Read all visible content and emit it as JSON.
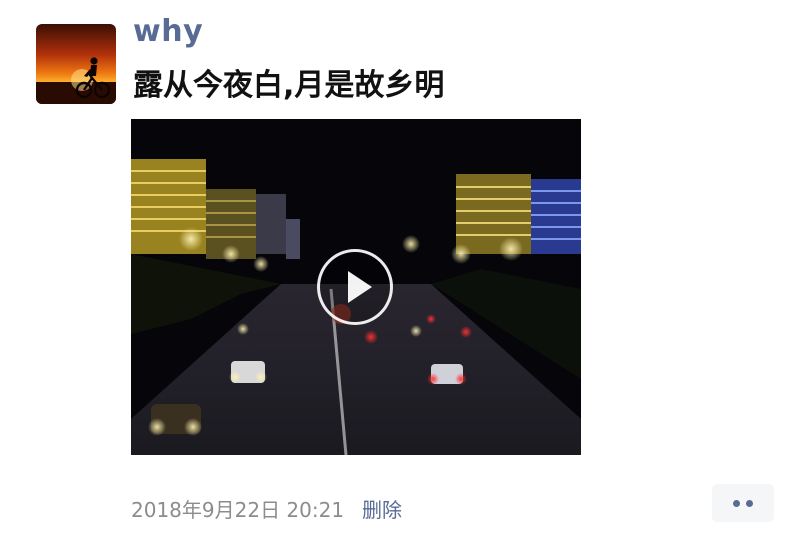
{
  "post": {
    "username": "why",
    "text": "露从今夜白,月是故乡明",
    "timestamp": "2018年9月22日 20:21",
    "delete_label": "删除"
  },
  "avatar": {
    "icon": "cyclist-sunset-avatar"
  },
  "video": {
    "thumbnail": "night-city-street-video-thumbnail",
    "play_icon": "play-icon"
  },
  "more": {
    "icon": "more-dots-icon"
  },
  "colors": {
    "link": "#576b95",
    "text": "#111111",
    "meta": "#8c8c8c",
    "more_bg": "#f5f6f8"
  }
}
